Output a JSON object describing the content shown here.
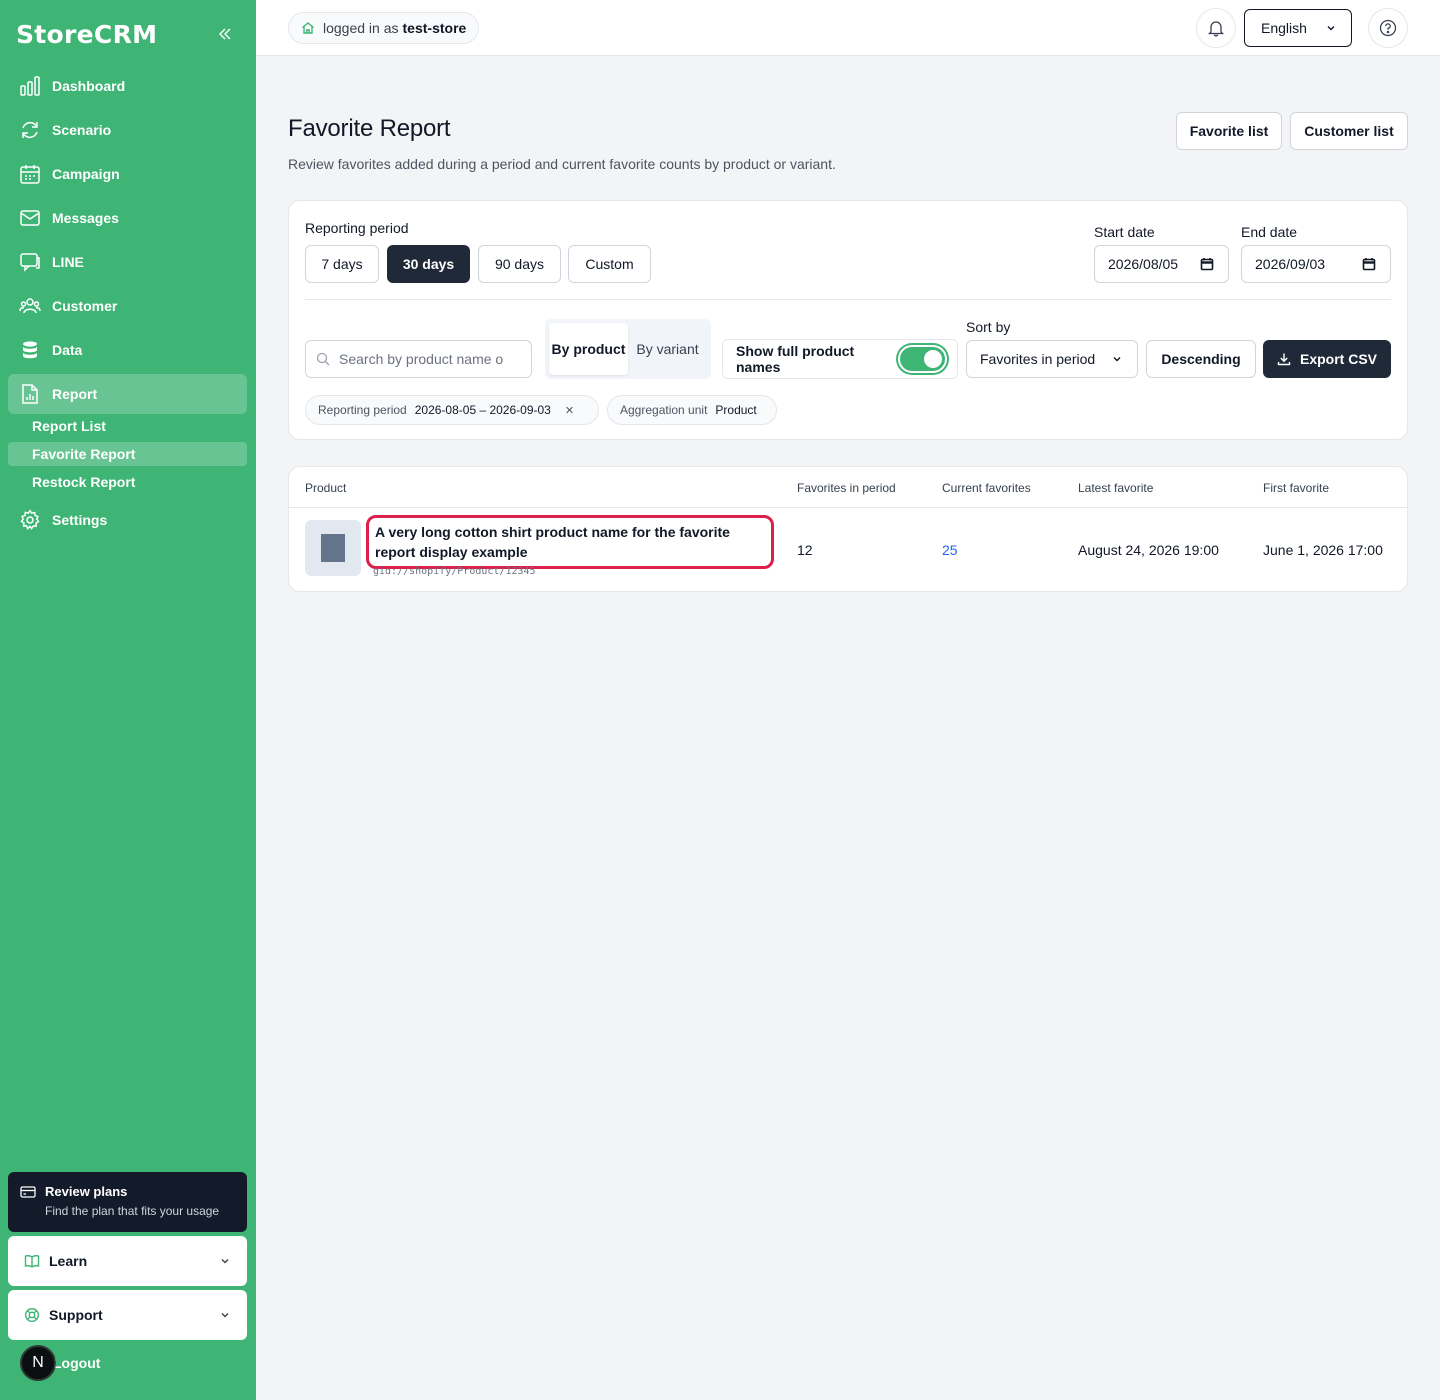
{
  "sidebar": {
    "brand": "StoreCRM",
    "items": [
      {
        "label": "Dashboard",
        "icon": "bar-chart-icon"
      },
      {
        "label": "Scenario",
        "icon": "refresh-icon"
      },
      {
        "label": "Campaign",
        "icon": "calendar-icon"
      },
      {
        "label": "Messages",
        "icon": "mail-icon"
      },
      {
        "label": "LINE",
        "icon": "chat-icon"
      },
      {
        "label": "Customer",
        "icon": "users-icon"
      },
      {
        "label": "Data",
        "icon": "database-icon"
      },
      {
        "label": "Report",
        "icon": "report-icon",
        "active": true
      }
    ],
    "sub_items": [
      {
        "label": "Report List"
      },
      {
        "label": "Favorite Report",
        "active": true
      },
      {
        "label": "Restock Report"
      }
    ],
    "settings": {
      "label": "Settings",
      "icon": "gear-icon"
    },
    "plans": {
      "title": "Review plans",
      "subtitle": "Find the plan that fits your usage"
    },
    "learn": "Learn",
    "support": "Support",
    "logout": "Logout",
    "avatar_letter": "N"
  },
  "topbar": {
    "login_prefix": "logged in as",
    "store": "test-store",
    "language": "English"
  },
  "header": {
    "title": "Favorite Report",
    "description": "Review favorites added during a period and current favorite counts by product or variant.",
    "favorite_list": "Favorite list",
    "customer_list": "Customer list"
  },
  "filters": {
    "period_label": "Reporting period",
    "periods": [
      "7 days",
      "30 days",
      "90 days",
      "Custom"
    ],
    "active_period": "30 days",
    "start_label": "Start date",
    "start_value": "2026/08/05",
    "end_label": "End date",
    "end_value": "2026/09/03",
    "search_placeholder": "Search by product name o",
    "by_product": "By product",
    "by_variant": "By variant",
    "full_names_label": "Show full product names",
    "full_names_on": true,
    "sort_label": "Sort by",
    "sort_value": "Favorites in period",
    "order": "Descending",
    "export": "Export CSV",
    "chips": [
      {
        "key": "Reporting period",
        "value": "2026-08-05 – 2026-09-03",
        "removable": true
      },
      {
        "key": "Aggregation unit",
        "value": "Product",
        "removable": false
      }
    ]
  },
  "table": {
    "columns": [
      "Product",
      "Favorites in period",
      "Current favorites",
      "Latest favorite",
      "First favorite"
    ],
    "rows": [
      {
        "name": "A very long cotton shirt product name for the favorite report display example",
        "gid": "gid://shopify/Product/12345",
        "favorites_in_period": "12",
        "current_favorites": "25",
        "latest": "August 24, 2026 19:00",
        "first": "June 1, 2026 17:00"
      }
    ]
  },
  "colors": {
    "sidebar": "#3eb575",
    "dark": "#1f2937",
    "highlight": "#dc1f4b",
    "link": "#2563eb"
  }
}
